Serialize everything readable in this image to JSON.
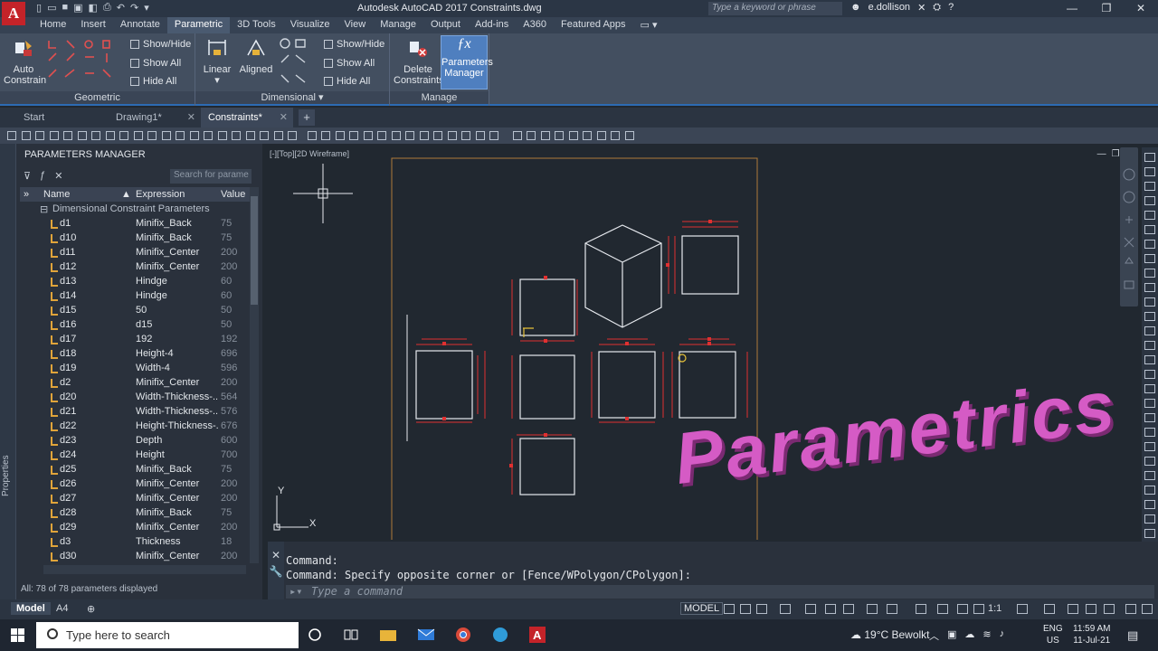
{
  "app": {
    "title": "Autodesk AutoCAD 2017   Constraints.dwg",
    "logo_letter": "A",
    "search_placeholder": "Type a keyword or phrase",
    "user": "e.dollison"
  },
  "ribbon_tabs": [
    "Home",
    "Insert",
    "Annotate",
    "Parametric",
    "3D Tools",
    "Visualize",
    "View",
    "Manage",
    "Output",
    "Add-ins",
    "A360",
    "Featured Apps"
  ],
  "active_ribbon_tab": "Parametric",
  "ribbon": {
    "auto_constrain": "Auto\nConstrain",
    "auto_constrain_l1": "Auto",
    "auto_constrain_l2": "Constrain",
    "geo_show_hide": "Show/Hide",
    "geo_show_all": "Show All",
    "geo_hide_all": "Hide All",
    "linear": "Linear",
    "aligned": "Aligned",
    "dim_show_hide": "Show/Hide",
    "dim_show_all": "Show All",
    "dim_hide_all": "Hide All",
    "delete_l1": "Delete",
    "delete_l2": "Constraints",
    "pm_l1": "Parameters",
    "pm_l2": "Manager",
    "panel_geometric": "Geometric",
    "panel_dimensional": "Dimensional",
    "panel_manage": "Manage"
  },
  "file_tabs": [
    {
      "label": "Start",
      "active": false
    },
    {
      "label": "Drawing1*",
      "active": false
    },
    {
      "label": "Constraints*",
      "active": true
    }
  ],
  "parameters_manager": {
    "title": "PARAMETERS MANAGER",
    "search_placeholder": "Search for parame",
    "col_name": "Name",
    "col_expression": "Expression",
    "col_value": "Value",
    "group_label": "Dimensional Constraint Parameters",
    "rows": [
      {
        "name": "d1",
        "expression": "Minifix_Back",
        "value": "75"
      },
      {
        "name": "d10",
        "expression": "Minifix_Back",
        "value": "75"
      },
      {
        "name": "d11",
        "expression": "Minifix_Center",
        "value": "200"
      },
      {
        "name": "d12",
        "expression": "Minifix_Center",
        "value": "200"
      },
      {
        "name": "d13",
        "expression": "Hindge",
        "value": "60"
      },
      {
        "name": "d14",
        "expression": "Hindge",
        "value": "60"
      },
      {
        "name": "d15",
        "expression": "50",
        "value": "50"
      },
      {
        "name": "d16",
        "expression": "d15",
        "value": "50"
      },
      {
        "name": "d17",
        "expression": "192",
        "value": "192"
      },
      {
        "name": "d18",
        "expression": "Height-4",
        "value": "696"
      },
      {
        "name": "d19",
        "expression": "Width-4",
        "value": "596"
      },
      {
        "name": "d2",
        "expression": "Minifix_Center",
        "value": "200"
      },
      {
        "name": "d20",
        "expression": "Width-Thickness-...",
        "value": "564"
      },
      {
        "name": "d21",
        "expression": "Width-Thickness-...",
        "value": "576"
      },
      {
        "name": "d22",
        "expression": "Height-Thickness-...",
        "value": "676"
      },
      {
        "name": "d23",
        "expression": "Depth",
        "value": "600"
      },
      {
        "name": "d24",
        "expression": "Height",
        "value": "700"
      },
      {
        "name": "d25",
        "expression": "Minifix_Back",
        "value": "75"
      },
      {
        "name": "d26",
        "expression": "Minifix_Center",
        "value": "200"
      },
      {
        "name": "d27",
        "expression": "Minifix_Center",
        "value": "200"
      },
      {
        "name": "d28",
        "expression": "Minifix_Back",
        "value": "75"
      },
      {
        "name": "d29",
        "expression": "Minifix_Center",
        "value": "200"
      },
      {
        "name": "d3",
        "expression": "Thickness",
        "value": "18"
      },
      {
        "name": "d30",
        "expression": "Minifix_Center",
        "value": "200"
      }
    ],
    "status": "All: 78 of 78 parameters displayed",
    "side_label": "Properties"
  },
  "viewport": {
    "label": "[-][Top][2D Wireframe]",
    "axis_x": "X",
    "axis_y": "Y"
  },
  "command": {
    "history1": "Command:",
    "history2": "Command: Specify opposite corner or [Fence/WPolygon/CPolygon]:",
    "placeholder": "Type a command"
  },
  "status_bar": {
    "layout_tabs": [
      "Model",
      "A4"
    ],
    "model_label": "MODEL",
    "scale": "1:1"
  },
  "taskbar": {
    "search_placeholder": "Type here to search",
    "weather": "19°C  Bewolkt",
    "lang1": "ENG",
    "lang2": "US",
    "time": "11:59 AM",
    "date": "11-Jul-21"
  },
  "overlay_text": "Parametrics"
}
